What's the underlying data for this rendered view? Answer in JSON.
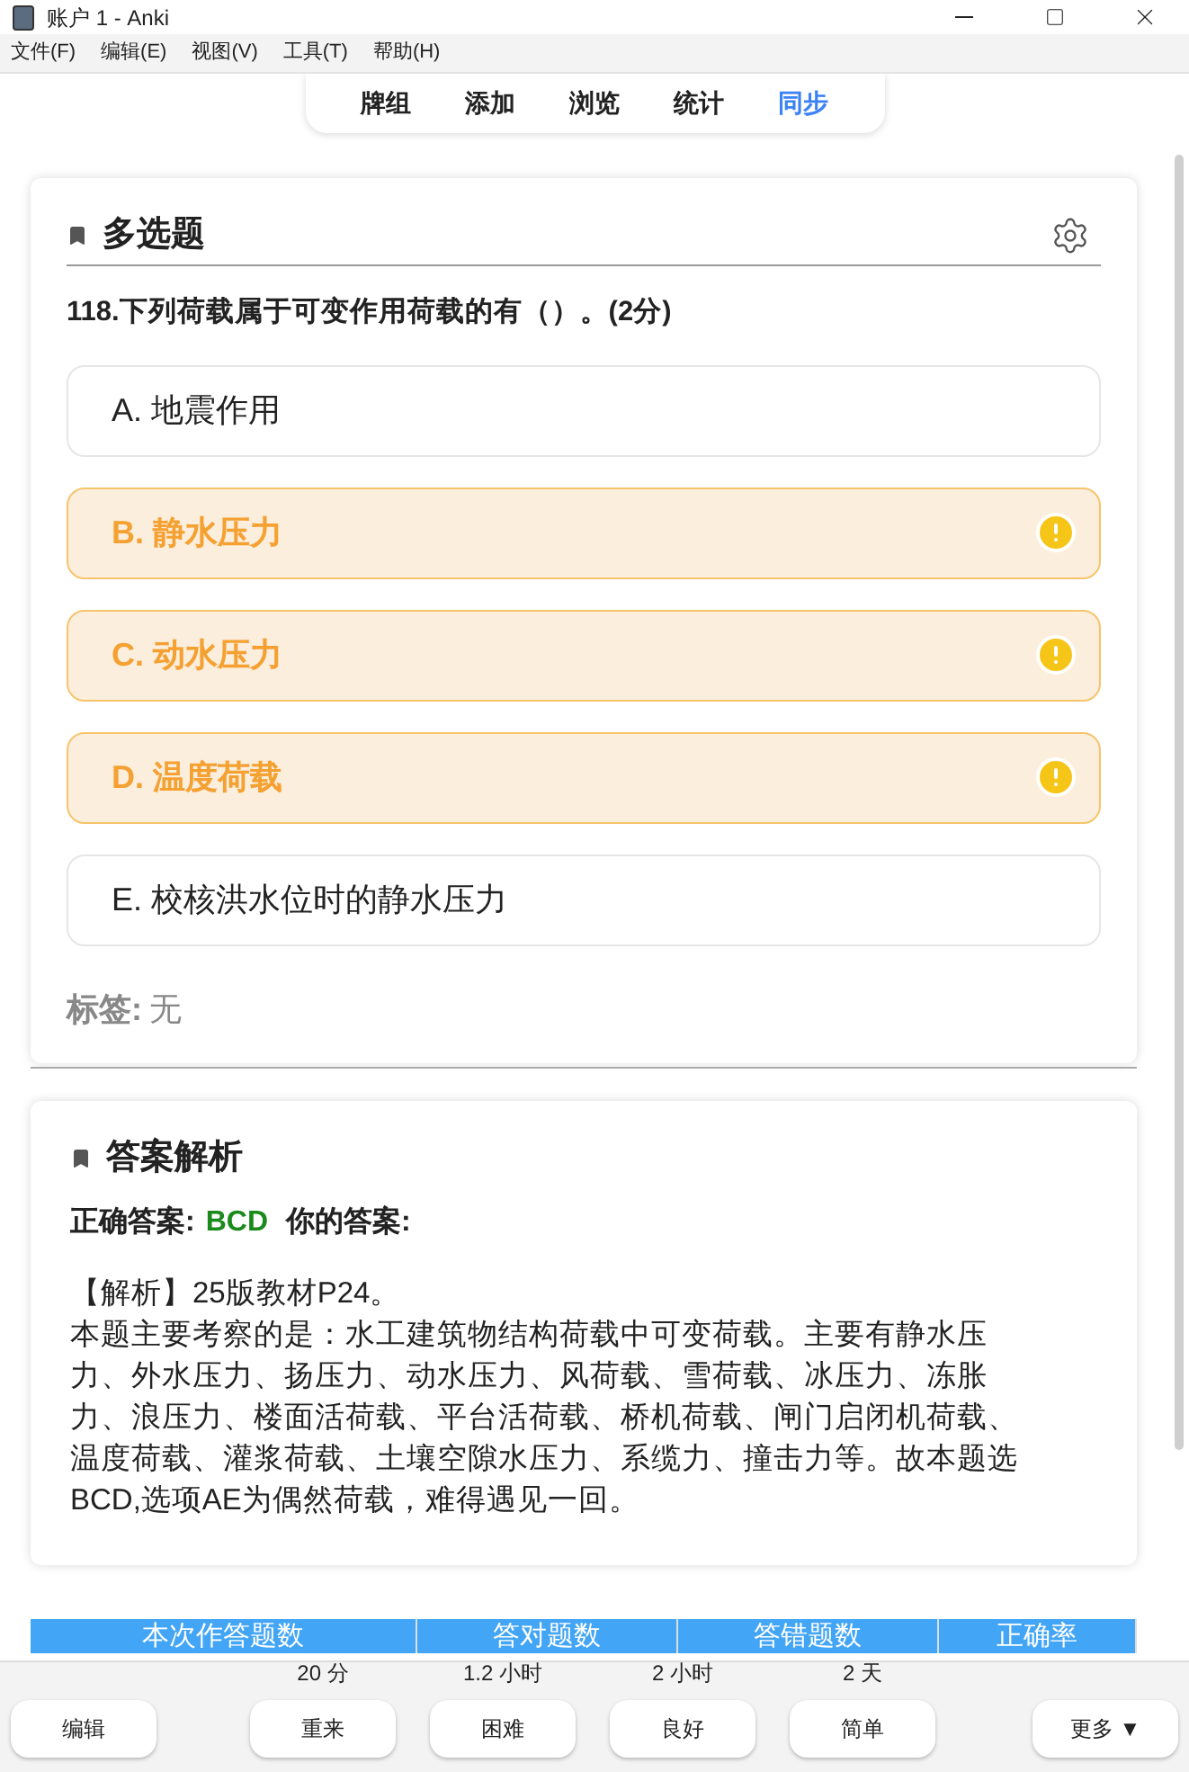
{
  "window": {
    "title": "账户 1 - Anki"
  },
  "menu": [
    "文件(F)",
    "编辑(E)",
    "视图(V)",
    "工具(T)",
    "帮助(H)"
  ],
  "tabs": [
    {
      "label": "牌组",
      "selected": false
    },
    {
      "label": "添加",
      "selected": false
    },
    {
      "label": "浏览",
      "selected": false
    },
    {
      "label": "统计",
      "selected": false
    },
    {
      "label": "同步",
      "selected": true
    }
  ],
  "question_card": {
    "title": "多选题",
    "question": "118.下列荷载属于可变作用荷载的有（）。(2分)",
    "options": [
      {
        "text": "A. 地震作用",
        "highlighted": false
      },
      {
        "text": "B. 静水压力",
        "highlighted": true
      },
      {
        "text": "C. 动水压力",
        "highlighted": true
      },
      {
        "text": "D. 温度荷载",
        "highlighted": true
      },
      {
        "text": "E. 校核洪水位时的静水压力",
        "highlighted": false
      }
    ],
    "tags_label": "标签:",
    "tags_value": "无"
  },
  "answer_card": {
    "title": "答案解析",
    "correct_label": "正确答案:",
    "correct_value": "BCD",
    "your_label": "你的答案:",
    "explanation": [
      "【解析】25版教材P24。",
      "本题主要考察的是：水工建筑物结构荷载中可变荷载。主要有静水压力、外水压力、扬压力、动水压力、风荷载、雪荷载、冰压力、冻胀力、浪压力、楼面活荷载、平台活荷载、桥机荷载、闸门启闭机荷载、温度荷载、灌浆荷载、土壤空隙水压力、系缆力、撞击力等。故本题选BCD,选项AE为偶然荷载，难得遇见一回。"
    ]
  },
  "stats_table": {
    "columns": [
      "本次作答题数",
      "答对题数",
      "答错题数",
      "正确率"
    ]
  },
  "bottom_bar": {
    "edit": "编辑",
    "answers": [
      {
        "interval": "20 分",
        "label": "重来"
      },
      {
        "interval": "1.2 小时",
        "label": "困难"
      },
      {
        "interval": "2 小时",
        "label": "良好"
      },
      {
        "interval": "2 天",
        "label": "简单"
      }
    ],
    "more": "更多 ▼"
  }
}
